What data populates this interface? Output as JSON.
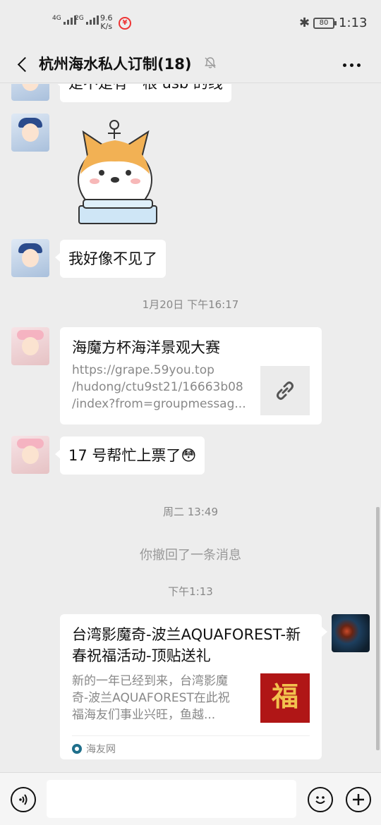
{
  "status_bar": {
    "network1": "4G",
    "network2": "2G",
    "speed_value": "9.6",
    "speed_unit": "K/s",
    "battery": "80",
    "time": "1:13",
    "icons": [
      "signal-icon",
      "unicom-icon",
      "bluetooth-icon",
      "battery-icon"
    ]
  },
  "header": {
    "title": "杭州海水私人订制(18)",
    "icons": [
      "back-arrow-icon",
      "mute-bell-icon",
      "more-dots-icon"
    ]
  },
  "messages": {
    "m1_partial": "是不是有一根 usb 的线",
    "m2_sticker": "corgi-sticker",
    "m3": "我好像不见了",
    "ts1": "1月20日 下午16:17",
    "link_card": {
      "title": "海魔方杯海洋景观大赛",
      "url": "https://grape.59you.top/hudong/ctu9st21/16663b08/index?from=groupmessag...",
      "url_line1": "https://grape.59you.top",
      "url_line2": "/hudong/ctu9st21/16663b08",
      "url_line3": "/index?from=groupmessag...",
      "thumb_icon": "link-icon"
    },
    "m5": "17 号帮忙上票了",
    "m5_emoji": "😳",
    "ts2": "周二 13:49",
    "recalled": "你撤回了一条消息",
    "ts3": "下午1:13",
    "article_card": {
      "title_line1": "台湾影魔奇-波兰AQUAFOREST-新",
      "title_line2": "春祝福活动-顶贴送礼",
      "desc_line1": "新的一年已经到来，台湾影魔",
      "desc_line2": "奇-波兰AQUAFOREST在此祝",
      "desc_line3": "福海友们事业兴旺，鱼越...",
      "thumb_text": "福",
      "source": "海友网"
    }
  },
  "input_bar": {
    "icons": [
      "voice-icon",
      "emoji-icon",
      "plus-icon"
    ],
    "text_value": ""
  },
  "colors": {
    "background": "#ededed",
    "bubble": "#ffffff",
    "timestamp": "#888888"
  }
}
